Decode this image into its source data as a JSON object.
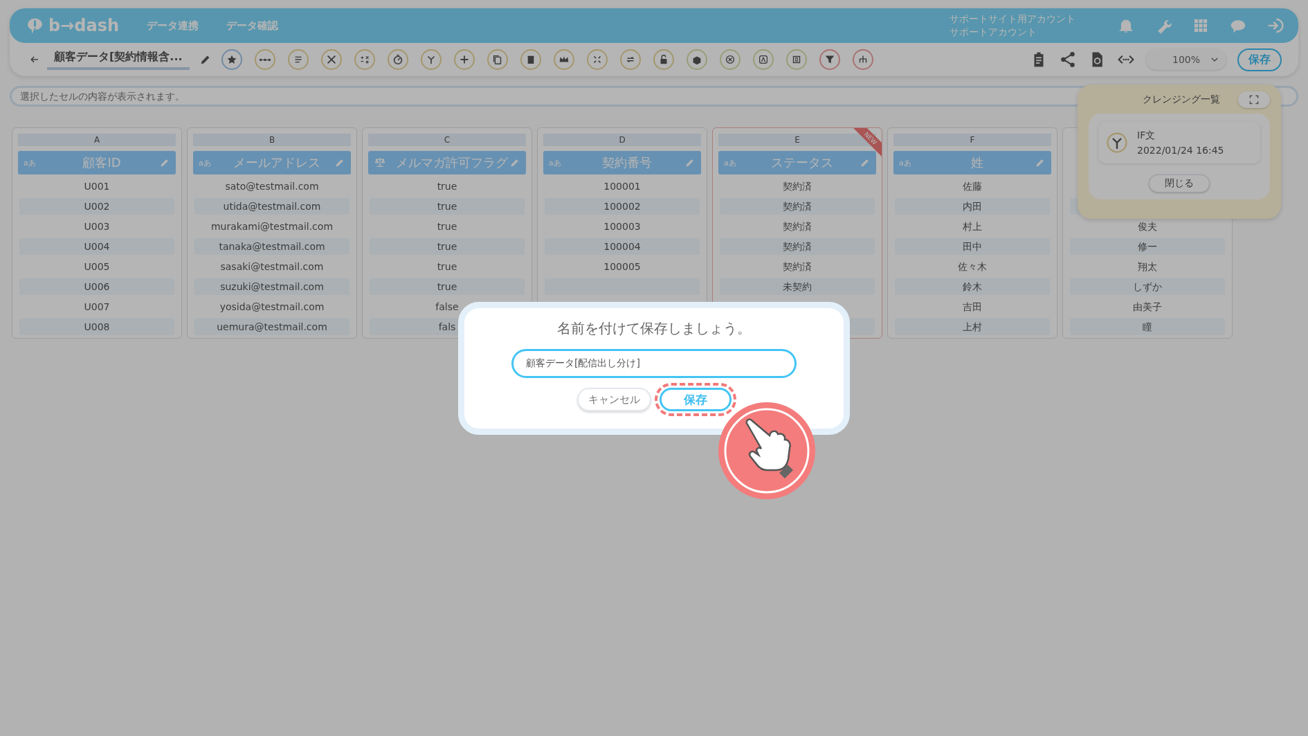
{
  "header": {
    "logo": "b→dash",
    "nav": [
      "データ連携",
      "データ確認"
    ],
    "account": [
      "サポートサイト用アカウント",
      "サポートアカウント"
    ]
  },
  "toolbar": {
    "title": "顧客データ[契約情報含...",
    "zoom": "100%",
    "save": "保存"
  },
  "cell_viewer": {
    "placeholder": "選択したセルの内容が表示されます。"
  },
  "columns": [
    {
      "letter": "A",
      "name": "顧客ID",
      "kind": "text",
      "type_badge": "aあ",
      "cells": [
        "U001",
        "U002",
        "U003",
        "U004",
        "U005",
        "U006",
        "U007",
        "U008"
      ]
    },
    {
      "letter": "B",
      "name": "メールアドレス",
      "kind": "text",
      "type_badge": "aあ",
      "cells": [
        "sato@testmail.com",
        "utida@testmail.com",
        "murakami@testmail.com",
        "tanaka@testmail.com",
        "sasaki@testmail.com",
        "suzuki@testmail.com",
        "yosida@testmail.com",
        "uemura@testmail.com"
      ]
    },
    {
      "letter": "C",
      "name": "メルマガ許可フラグ",
      "kind": "boolean",
      "cells": [
        "true",
        "true",
        "true",
        "true",
        "true",
        "true",
        "false",
        "fals"
      ]
    },
    {
      "letter": "D",
      "name": "契約番号",
      "kind": "text",
      "type_badge": "aあ",
      "cells": [
        "100001",
        "100002",
        "100003",
        "100004",
        "100005"
      ]
    },
    {
      "letter": "E",
      "name": "ステータス",
      "kind": "text",
      "type_badge": "aあ",
      "new": true,
      "new_label": "NEW",
      "cells": [
        "契約済",
        "契約済",
        "契約済",
        "契約済",
        "契約済",
        "未契約"
      ]
    },
    {
      "letter": "F",
      "name": "姓",
      "kind": "text",
      "type_badge": "aあ",
      "cells": [
        "佐藤",
        "内田",
        "村上",
        "田中",
        "佐々木",
        "鈴木",
        "吉田",
        "上村"
      ]
    },
    {
      "kind": "hidden",
      "covered_top": true,
      "cells": [
        "俊夫",
        "修一",
        "翔太",
        "しずか",
        "由美子",
        "瞳"
      ]
    }
  ],
  "cleansing_panel": {
    "title": "クレンジング一覧",
    "items": [
      {
        "name": "IF文",
        "date": "2022/01/24 16:45"
      }
    ],
    "close": "閉じる"
  },
  "dialog": {
    "title": "名前を付けて保存しましょう。",
    "value": "顧客データ[配信出し分け]",
    "buttons": [
      {
        "label": "キャンセル",
        "kind": "secondary",
        "highlighted": false
      },
      {
        "label": "保存",
        "kind": "primary",
        "highlighted": true
      }
    ]
  }
}
